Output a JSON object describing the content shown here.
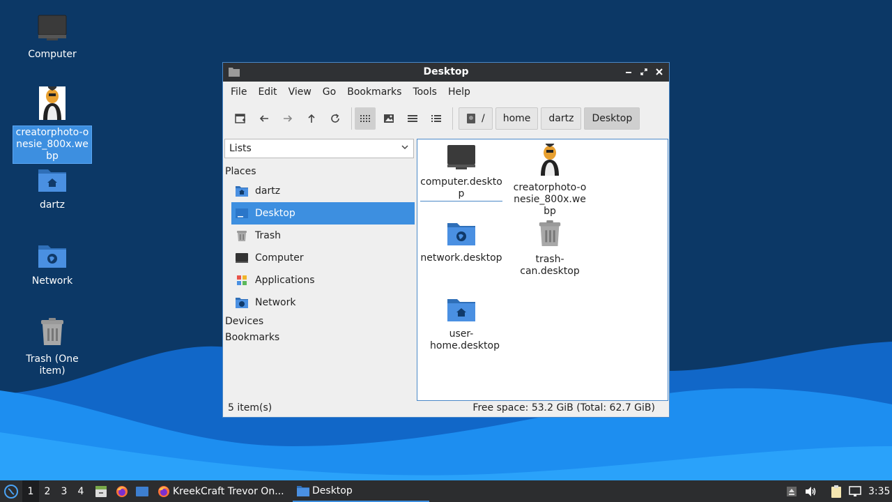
{
  "desktop": {
    "icons": [
      {
        "name": "desktop-icon-computer",
        "label": "Computer",
        "icon": "monitor-icon"
      },
      {
        "name": "desktop-icon-creatorphoto",
        "label": "creatorphoto-onesie_800x.webp",
        "icon": "image-thumbnail"
      },
      {
        "name": "desktop-icon-dartz",
        "label": "dartz",
        "icon": "home-folder-icon"
      },
      {
        "name": "desktop-icon-network",
        "label": "Network",
        "icon": "network-folder-icon"
      },
      {
        "name": "desktop-icon-trash",
        "label": "Trash (One item)",
        "icon": "trash-icon"
      }
    ]
  },
  "window": {
    "title": "Desktop",
    "controls": [
      "minimize-icon",
      "maximize-icon",
      "close-icon"
    ],
    "menu": [
      "File",
      "Edit",
      "View",
      "Go",
      "Bookmarks",
      "Tools",
      "Help"
    ],
    "toolbar": {
      "buttons": [
        "new-tab-icon",
        "back-icon",
        "forward-icon",
        "up-icon",
        "reload-icon",
        "icon-view-icon",
        "thumbnail-view-icon",
        "compact-view-icon",
        "detailed-list-view-icon"
      ],
      "active_view": "icon-view"
    },
    "path": {
      "root_label": "/",
      "crumbs": [
        "home",
        "dartz",
        "Desktop"
      ],
      "current": "Desktop"
    },
    "sidebar": {
      "mode": "Lists",
      "sections": {
        "places": "Places",
        "devices": "Devices",
        "bookmarks": "Bookmarks"
      },
      "places": [
        {
          "label": "dartz",
          "icon": "home-folder-icon"
        },
        {
          "label": "Desktop",
          "icon": "desktop-icon",
          "selected": true
        },
        {
          "label": "Trash",
          "icon": "trash-icon"
        },
        {
          "label": "Computer",
          "icon": "monitor-icon"
        },
        {
          "label": "Applications",
          "icon": "applications-icon"
        },
        {
          "label": "Network",
          "icon": "network-folder-icon"
        }
      ]
    },
    "files": [
      {
        "label": "computer.desktop",
        "icon": "monitor-icon"
      },
      {
        "label": "creatorphoto-onesie_800x.webp",
        "icon": "image-thumbnail"
      },
      {
        "label": "network.desktop",
        "icon": "network-folder-icon"
      },
      {
        "label": "trash-can.desktop",
        "icon": "trash-icon"
      },
      {
        "label": "user-home.desktop",
        "icon": "home-folder-icon"
      }
    ],
    "status": {
      "count": "5 item(s)",
      "free": "Free space: 53.2 GiB (Total: 62.7 GiB)"
    }
  },
  "taskbar": {
    "workspaces": [
      "1",
      "2",
      "3",
      "4"
    ],
    "active_workspace": "1",
    "tasks": [
      {
        "label": "KreekCraft Trevor On...",
        "icon": "firefox-icon"
      },
      {
        "label": "Desktop",
        "icon": "folder-icon",
        "active": true
      }
    ],
    "clock": "3:35"
  },
  "colors": {
    "accent": "#3d8fe0",
    "desktop_bg": "#0e3a6b",
    "titlebar": "#2f3134",
    "taskbar": "#2c2d2f"
  }
}
